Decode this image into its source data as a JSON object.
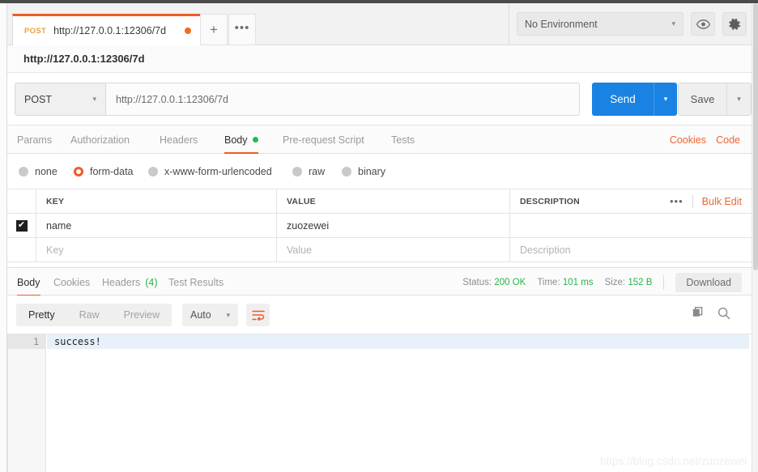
{
  "window": {
    "tab": {
      "method": "POST",
      "url": "http://127.0.0.1:12306/7d",
      "unsaved_dot": "unsaved-indicator",
      "new_tab_label": "+",
      "more_label": "•••"
    },
    "environment": {
      "selected": "No Environment",
      "caret": "▾",
      "eye_icon": "eye-icon",
      "gear_icon": "gear-icon"
    }
  },
  "request": {
    "title": "http://127.0.0.1:12306/7d",
    "method": "POST",
    "method_caret": "▾",
    "url_value": "http://127.0.0.1:12306/7d",
    "send_label": "Send",
    "send_caret": "▾",
    "save_label": "Save",
    "save_caret": "▾",
    "tabs": [
      {
        "label": "Params",
        "active": false
      },
      {
        "label": "Authorization",
        "active": false
      },
      {
        "label": "Headers",
        "active": false
      },
      {
        "label": "Body",
        "active": true
      },
      {
        "label": "Pre-request Script",
        "active": false
      },
      {
        "label": "Tests",
        "active": false
      }
    ],
    "links": [
      {
        "label": "Cookies"
      },
      {
        "label": "Code"
      }
    ],
    "body_types": [
      {
        "label": "none",
        "selected": false
      },
      {
        "label": "form-data",
        "selected": true
      },
      {
        "label": "x-www-form-urlencoded",
        "selected": false
      },
      {
        "label": "raw",
        "selected": false
      },
      {
        "label": "binary",
        "selected": false
      }
    ],
    "table": {
      "headers": {
        "key": "KEY",
        "value": "VALUE",
        "description": "DESCRIPTION"
      },
      "tools": {
        "dots": "•••",
        "bulk_edit": "Bulk Edit"
      },
      "rows": [
        {
          "checked": true,
          "check_glyph": "✔",
          "key": "name",
          "value": "zuozewei",
          "description": ""
        }
      ],
      "placeholders": {
        "key": "Key",
        "value": "Value",
        "description": "Description"
      }
    }
  },
  "response": {
    "tabs": [
      {
        "label": "Body",
        "count": "",
        "active": true
      },
      {
        "label": "Cookies",
        "count": "",
        "active": false
      },
      {
        "label": "Headers",
        "count": "(4)",
        "active": false
      },
      {
        "label": "Test Results",
        "count": "",
        "active": false
      }
    ],
    "meta": {
      "status_label": "Status:",
      "status_value": "200 OK",
      "time_label": "Time:",
      "time_value": "101 ms",
      "size_label": "Size:",
      "size_value": "152 B",
      "download_label": "Download"
    },
    "viewmodes": [
      {
        "label": "Pretty",
        "active": true
      },
      {
        "label": "Raw",
        "active": false
      },
      {
        "label": "Preview",
        "active": false
      }
    ],
    "format": {
      "selected": "Auto",
      "caret": "▾"
    },
    "wrap_icon": "word-wrap-icon",
    "copy_icon": "copy-icon",
    "search_icon": "search-icon",
    "body": {
      "line_number": "1",
      "text": "success!"
    }
  },
  "watermark": "https://blog.csdn.net/zuozewei",
  "colors": {
    "accent_orange": "#ef5b25",
    "link_orange": "#ef6432",
    "send_blue": "#1a82e2",
    "status_green": "#2ab34a",
    "dot_green": "#1abc56"
  }
}
